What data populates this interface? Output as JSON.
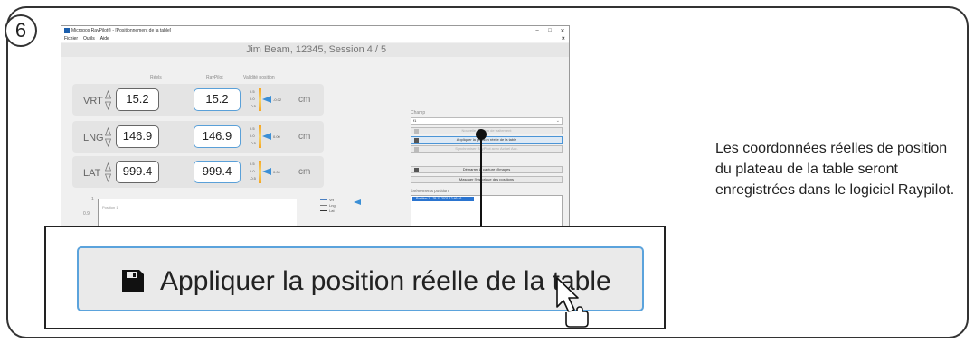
{
  "step": {
    "number": "6"
  },
  "window": {
    "title": "Micropos RayPilot® - [Positionnement de la table]",
    "controls": {
      "minimize": "–",
      "maximize": "□",
      "close": "✕"
    },
    "menu": [
      "Fichier",
      "Outils",
      "Aide"
    ],
    "menu_close": "✕"
  },
  "session": {
    "title": "Jim Beam, 12345, Session 4 / 5"
  },
  "columns": {
    "reels": "Réels",
    "raypilot": "RayPilot",
    "validite": "Validité position"
  },
  "rows": [
    {
      "label": "VRT",
      "real": "15.2",
      "raypilot": "15.2",
      "scale": [
        "0.5",
        "0.0",
        "-0.5"
      ],
      "pointer_value": "-0.02",
      "unit": "cm"
    },
    {
      "label": "LNG",
      "real": "146.9",
      "raypilot": "146.9",
      "scale": [
        "0.5",
        "0.0",
        "-0.5"
      ],
      "pointer_value": "0.00",
      "unit": "cm"
    },
    {
      "label": "LAT",
      "real": "999.4",
      "raypilot": "999.4",
      "scale": [
        "0.5",
        "0.0",
        "-0.5"
      ],
      "pointer_value": "0.00",
      "unit": "cm"
    }
  ],
  "graph": {
    "axis_top": "1",
    "axis_mid": "0.9",
    "label": "Position 1",
    "legend": [
      "Vrt",
      "Lng",
      "Lat"
    ]
  },
  "right_panel": {
    "champ_label": "Champ",
    "field_value": "f1",
    "btn_nouvelle": "Nouvelle position de traitement",
    "btn_appliquer": "Appliquer la position réelle de la table",
    "btn_synchroniser": "Synchroniser RayPilot avec Actuel Acc.",
    "btn_demarrer": "Démarrer la capture d'images",
    "btn_masquer": "Masquer l'historique des positions",
    "events_label": "Événements position",
    "event_item": "Position 1 - 25.11.2021 12:46:46"
  },
  "zoom": {
    "button_text": "Appliquer la position réelle de la table"
  },
  "description": "Les coordonnées réelles de position du plateau de la table seront enregistrées dans le logiciel Raypilot."
}
